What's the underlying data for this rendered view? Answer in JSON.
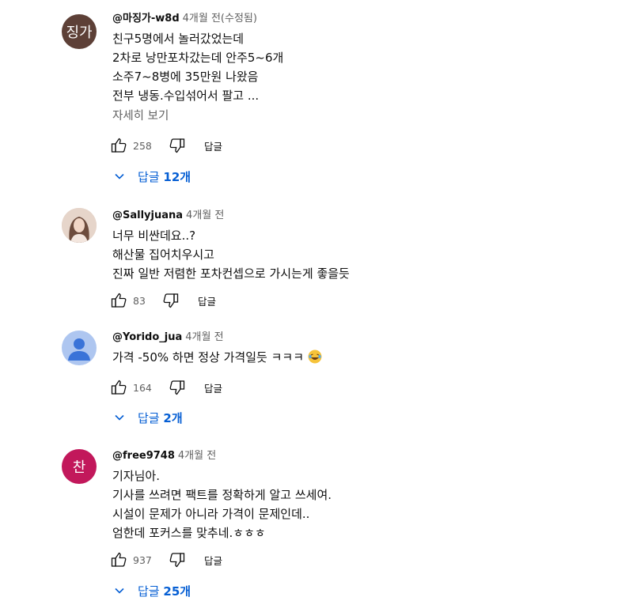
{
  "comments": [
    {
      "avatar_text": "징가",
      "avatar_color": "#5d4037",
      "author": "@마징가-w8d",
      "time": "4개월 전(수정됨)",
      "lines": [
        "친구5명에서 놀러갔었는데",
        "2차로 낭만포차갔는데 안주5~6개",
        "소주7~8병에 35만원 나왔음",
        "전부 냉동.수입섞어서 팔고 ..."
      ],
      "more": "자세히 보기",
      "likes": "258",
      "reply_label": "답글",
      "replies_label": "답글",
      "replies_count": "12개"
    },
    {
      "avatar_text": "",
      "avatar_color": "#d8c2b4",
      "author": "@Sallyjuana",
      "time": "4개월 전",
      "lines": [
        "너무 비싼데요..?",
        "해산물 집어치우시고",
        "진짜 일반 저렴한 포차컨셉으로 가시는게 좋을듯"
      ],
      "likes": "83",
      "reply_label": "답글"
    },
    {
      "avatar_text": "",
      "avatar_color": "#aec6f0",
      "author": "@Yorido_jua",
      "time": "4개월 전",
      "lines": [
        "가격 -50% 하면 정상 가격일듯 ㅋㅋㅋ"
      ],
      "likes": "164",
      "reply_label": "답글",
      "replies_label": "답글",
      "replies_count": "2개"
    },
    {
      "avatar_text": "찬",
      "avatar_color": "#c2185b",
      "author": "@free9748",
      "time": "4개월 전",
      "lines": [
        "기자님아.",
        "기사를 쓰려면 팩트를 정확하게 알고 쓰세여.",
        "시설이 문제가 아니라 가격이 문제인데..",
        "엄한데 포커스를 맞추네.ㅎㅎㅎ"
      ],
      "likes": "937",
      "reply_label": "답글",
      "replies_label": "답글",
      "replies_count": "25개"
    }
  ],
  "colors": {
    "link": "#065fd4",
    "muted": "#606060"
  }
}
